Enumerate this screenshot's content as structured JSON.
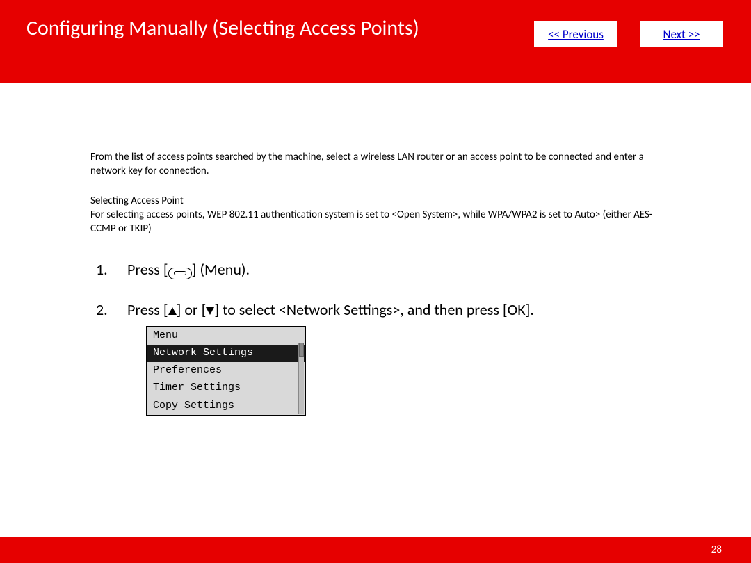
{
  "header": {
    "title": "Configuring Manually (Selecting Access Points)",
    "prev_label": " << Previous",
    "next_label": "Next >>"
  },
  "body": {
    "intro": "From the list of access points searched by the machine, select a wireless LAN router or an access point to be connected and enter a network key for connection.",
    "sub_heading": "Selecting Access Point",
    "sub_para": "For selecting access points, WEP 802.11 authentication system is set to <Open System>, while WPA/WPA2 is set to Auto> (either AES-CCMP or TKIP)",
    "step1_prefix": "Press [",
    "step1_suffix": "] (Menu).",
    "step2_prefix": "Press [",
    "step2_mid": "] or [",
    "step2_suffix": "] to select <Network Settings>, and then press [OK].",
    "lcd": {
      "title": "Menu",
      "item_selected": "Network Settings",
      "item2": "Preferences",
      "item3": "Timer Settings",
      "item4": "Copy Settings"
    }
  },
  "footer": {
    "page_number": "28"
  }
}
